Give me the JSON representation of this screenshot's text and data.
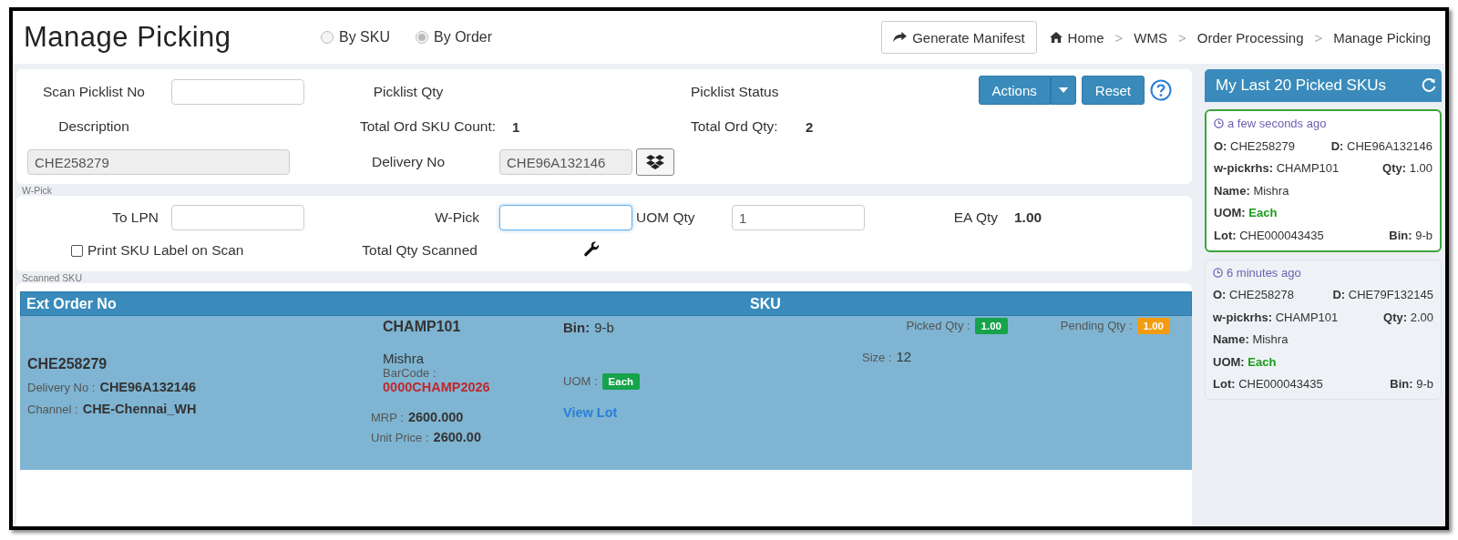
{
  "header": {
    "title": "Manage Picking",
    "modes": [
      {
        "label": "By SKU",
        "selected": false
      },
      {
        "label": "By Order",
        "selected": true
      }
    ],
    "manifest_button": "Generate Manifest",
    "breadcrumbs": [
      {
        "label": "Home"
      },
      {
        "separator": ">",
        "label": "WMS"
      },
      {
        "separator": ">",
        "label": "Order Processing"
      },
      {
        "separator": ">",
        "label": "Manage Picking"
      }
    ]
  },
  "picklist": {
    "scan_label": "Scan Picklist No",
    "qty_label": "Picklist Qty",
    "status_label": "Picklist Status",
    "actions_button": "Actions",
    "reset_button": "Reset",
    "description_label": "Description",
    "sku_count_label": "Total Ord SKU Count:",
    "sku_count": "1",
    "ord_qty_label": "Total Ord Qty:",
    "ord_qty": "2",
    "description": {
      "value": "CHE258279",
      "disabled": true
    },
    "delivery_label": "Delivery No",
    "delivery": {
      "value": "CHE96A132146",
      "disabled": true
    }
  },
  "wpick": {
    "legend": "W-Pick",
    "to_lpn_label": "To LPN",
    "wpick_label": "W-Pick",
    "wpick_focused": true,
    "uom_qty_label": "UOM Qty",
    "uom_qty": "1",
    "ea_qty_label": "EA Qty",
    "ea_qty": "1.00",
    "print_label": "Print SKU Label on Scan",
    "print_checked": false,
    "total_scanned_label": "Total Qty Scanned"
  },
  "scanned": {
    "legend": "Scanned SKU",
    "columns": [
      "Ext Order No",
      "SKU"
    ],
    "rows": [
      {
        "order_no": "CHE258279",
        "delivery_label": "Delivery No :",
        "delivery": "CHE96A132146",
        "channel_label": "Channel :",
        "channel": "CHE-Chennai_WH",
        "sku": "CHAMP101",
        "name": "Mishra",
        "barcode_label": "BarCode :",
        "barcode": "0000CHAMP2026",
        "mrp_label": "MRP :",
        "mrp": "2600.000",
        "unit_price_label": "Unit Price :",
        "unit_price": "2600.00",
        "bin_label": "Bin:",
        "bin": "9-b",
        "uom_label": "UOM :",
        "uom": "Each",
        "view_lot": "View Lot",
        "picked_label": "Picked Qty :",
        "picked": "1.00",
        "size_label": "Size :",
        "size": "12",
        "pending_label": "Pending Qty :",
        "pending": "1.00"
      }
    ]
  },
  "recent": {
    "title": "My Last 20 Picked SKUs",
    "items": [
      {
        "time": "a few seconds ago",
        "selected": true,
        "rows": [
          [
            {
              "label": "O:",
              "value": "CHE258279",
              "kind": "plain"
            },
            {
              "label": "D:",
              "value": "CHE96A132146",
              "kind": "plain"
            }
          ],
          [
            {
              "label": "w-pickrhs:",
              "value": "CHAMP101",
              "kind": "plain"
            },
            {
              "label": "Qty:",
              "value": "1.00",
              "kind": "plain"
            }
          ],
          [
            {
              "label": "Name:",
              "value": "Mishra",
              "kind": "plain"
            }
          ],
          [
            {
              "label": "UOM:",
              "value": "Each",
              "kind": "accent"
            }
          ],
          [
            {
              "label": "Lot:",
              "value": "CHE000043435",
              "kind": "plain"
            },
            {
              "label": "Bin:",
              "value": "9-b",
              "kind": "plain"
            }
          ]
        ]
      },
      {
        "time": "6 minutes ago",
        "selected": false,
        "rows": [
          [
            {
              "label": "O:",
              "value": "CHE258278",
              "kind": "plain"
            },
            {
              "label": "D:",
              "value": "CHE79F132145",
              "kind": "plain"
            }
          ],
          [
            {
              "label": "w-pickrhs:",
              "value": "CHAMP101",
              "kind": "plain"
            },
            {
              "label": "Qty:",
              "value": "2.00",
              "kind": "plain"
            }
          ],
          [
            {
              "label": "Name:",
              "value": "Mishra",
              "kind": "plain"
            }
          ],
          [
            {
              "label": "UOM:",
              "value": "Each",
              "kind": "accent"
            }
          ],
          [
            {
              "label": "Lot:",
              "value": "CHE000043435",
              "kind": "plain"
            },
            {
              "label": "Bin:",
              "value": "9-b",
              "kind": "plain"
            }
          ]
        ]
      }
    ]
  }
}
